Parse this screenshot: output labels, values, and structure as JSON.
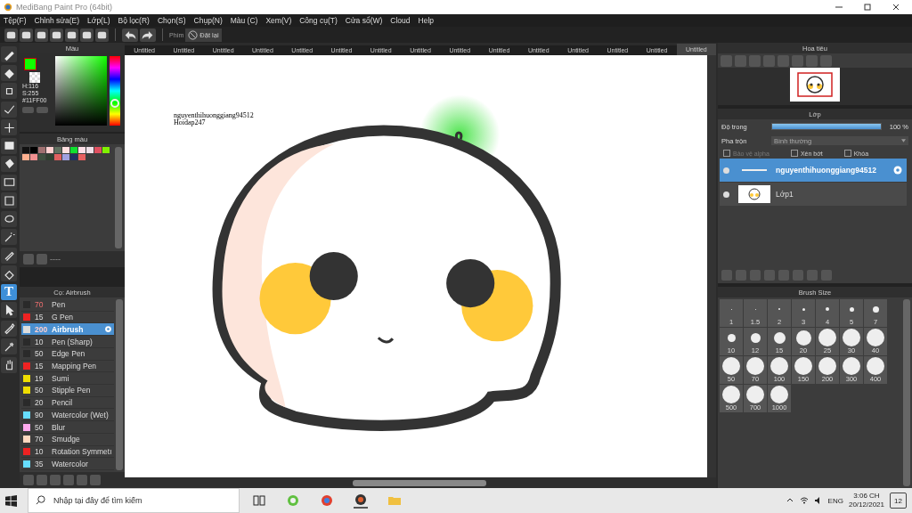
{
  "window": {
    "title": "MediBang Paint Pro (64bit)"
  },
  "menu": [
    "Tệp(F)",
    "Chỉnh sửa(E)",
    "Lớp(L)",
    "Bộ lọc(R)",
    "Chọn(S)",
    "Chụp(N)",
    "Màu (C)",
    "Xem(V)",
    "Công cụ(T)",
    "Cửa sổ(W)",
    "Cloud",
    "Help"
  ],
  "toolbar": {
    "shortcut_label": "Phím",
    "reset_button": "Đặt lại"
  },
  "tools": [
    {
      "kind": "brush",
      "selected": false
    },
    {
      "kind": "eraser",
      "selected": false
    },
    {
      "kind": "dot",
      "selected": false
    },
    {
      "kind": "line",
      "selected": false
    },
    {
      "kind": "move",
      "selected": false
    },
    {
      "kind": "fill",
      "selected": false
    },
    {
      "kind": "bucket",
      "selected": false
    },
    {
      "kind": "gradient",
      "selected": false
    },
    {
      "kind": "select",
      "selected": false
    },
    {
      "kind": "lasso",
      "selected": false
    },
    {
      "kind": "wand",
      "selected": false
    },
    {
      "kind": "selectpen",
      "selected": false
    },
    {
      "kind": "selecterase",
      "selected": false
    },
    {
      "kind": "text",
      "glyph": "T",
      "selected": true
    },
    {
      "kind": "pointer",
      "selected": false
    },
    {
      "kind": "pen",
      "selected": false
    },
    {
      "kind": "dropper",
      "selected": false
    },
    {
      "kind": "hand",
      "selected": false
    }
  ],
  "color_panel": {
    "title": "Màu",
    "color": "#11ff00",
    "h": "H:116",
    "s": "S:255",
    "hex": "#11FF00"
  },
  "palette_panel": {
    "title": "Bảng màu",
    "colors": [
      {
        "color": "#111111"
      },
      {
        "color": "#000000"
      },
      {
        "color": "#a07070"
      },
      {
        "color": "#ffd0d0"
      },
      {
        "color": "#607060"
      },
      {
        "color": "#ffe0e0"
      },
      {
        "color": "#10e030"
      },
      {
        "color": "#ffe0e8"
      },
      {
        "color": "#f0e0e8"
      },
      {
        "color": "#e05060"
      },
      {
        "color": "#80f000"
      },
      {
        "color": "#ffb090"
      },
      {
        "color": "#f09090"
      },
      {
        "color": "#405040"
      },
      {
        "color": "#304030"
      },
      {
        "color": "#e06060"
      },
      {
        "color": "#a0a0e0"
      },
      {
        "color": "#203060"
      },
      {
        "color": "#e86060"
      }
    ],
    "footer": "----"
  },
  "brush_panel": {
    "title": "Cọ: Airbrush",
    "brushes": [
      {
        "size": "70",
        "name": "Pen",
        "color": "#2a2a2a",
        "size_alert": true,
        "selected": false
      },
      {
        "size": "15",
        "name": "G Pen",
        "color": "#ee2222",
        "size_alert": false,
        "selected": false
      },
      {
        "size": "200",
        "name": "Airbrush",
        "color": "#dddddd",
        "size_alert": true,
        "selected": true
      },
      {
        "size": "10",
        "name": "Pen (Sharp)",
        "color": "#2a2a2a",
        "size_alert": false,
        "selected": false
      },
      {
        "size": "50",
        "name": "Edge Pen",
        "color": "#2a2a2a",
        "size_alert": false,
        "selected": false
      },
      {
        "size": "15",
        "name": "Mapping Pen",
        "color": "#ee2222",
        "size_alert": false,
        "selected": false
      },
      {
        "size": "19",
        "name": "Sumi",
        "color": "#eedd00",
        "size_alert": false,
        "selected": false
      },
      {
        "size": "50",
        "name": "Stipple Pen",
        "color": "#eedd00",
        "size_alert": false,
        "selected": false
      },
      {
        "size": "20",
        "name": "Pencil",
        "color": "#2a2a2a",
        "size_alert": false,
        "selected": false
      },
      {
        "size": "90",
        "name": "Watercolor (Wet)",
        "color": "#66ddff",
        "size_alert": false,
        "selected": false
      },
      {
        "size": "50",
        "name": "Blur",
        "color": "#ffaaee",
        "size_alert": false,
        "selected": false
      },
      {
        "size": "70",
        "name": "Smudge",
        "color": "#ffd8c0",
        "size_alert": false,
        "selected": false
      },
      {
        "size": "10",
        "name": "Rotation Symmetı",
        "color": "#ee2222",
        "size_alert": false,
        "selected": false
      },
      {
        "size": "35",
        "name": "Watercolor",
        "color": "#66ddff",
        "size_alert": false,
        "selected": false
      }
    ]
  },
  "tabs": [
    {
      "label": "Untitled",
      "selected": false
    },
    {
      "label": "Untitled",
      "selected": false
    },
    {
      "label": "Untitled",
      "selected": false
    },
    {
      "label": "Untitled",
      "selected": false
    },
    {
      "label": "Untitled",
      "selected": false
    },
    {
      "label": "Untitled",
      "selected": false
    },
    {
      "label": "Untitled",
      "selected": false
    },
    {
      "label": "Untitled",
      "selected": false
    },
    {
      "label": "Untitled",
      "selected": false
    },
    {
      "label": "Untitled",
      "selected": false
    },
    {
      "label": "Untitled",
      "selected": false
    },
    {
      "label": "Untitled",
      "selected": false
    },
    {
      "label": "Untitled",
      "selected": false
    },
    {
      "label": "Untitled",
      "selected": false
    },
    {
      "label": "Untitled",
      "selected": true
    }
  ],
  "canvas_text": [
    "nguyenthihuonggiang94512",
    "Hoidap247"
  ],
  "navigator_panel": {
    "title": "Hoa tiêu"
  },
  "layer_panel": {
    "title": "Lớp",
    "opacity_label": "Độ trong",
    "opacity": {
      "level": 1.0,
      "reading": "100 %"
    },
    "blend_label": "Pha trộn",
    "blend_value": "Bình thường",
    "options": [
      {
        "label": "Bảo vệ alpha",
        "checked": false,
        "disabled": true
      },
      {
        "label": "Xén bớt",
        "checked": false,
        "disabled": false
      },
      {
        "label": "Khóa",
        "checked": false,
        "disabled": false
      }
    ],
    "layers": [
      {
        "name": "nguyenthihuonggiang94512",
        "kind": "text",
        "visible": true,
        "selected": true
      },
      {
        "name": "Lớp1",
        "kind": "image",
        "visible": true,
        "selected": false
      }
    ]
  },
  "brush_size_panel": {
    "title": "Brush Size",
    "sizes": [
      "1",
      "1.5",
      "2",
      "3",
      "4",
      "5",
      "7",
      "10",
      "12",
      "15",
      "20",
      "25",
      "30",
      "40",
      "50",
      "70",
      "100",
      "150",
      "200",
      "300",
      "400",
      "500",
      "700",
      "1000"
    ]
  },
  "taskbar": {
    "search_placeholder": "Nhập tại đây để tìm kiếm",
    "language": "ENG",
    "time": "3:06 CH",
    "date": "20/12/2021",
    "notifications": "12"
  }
}
